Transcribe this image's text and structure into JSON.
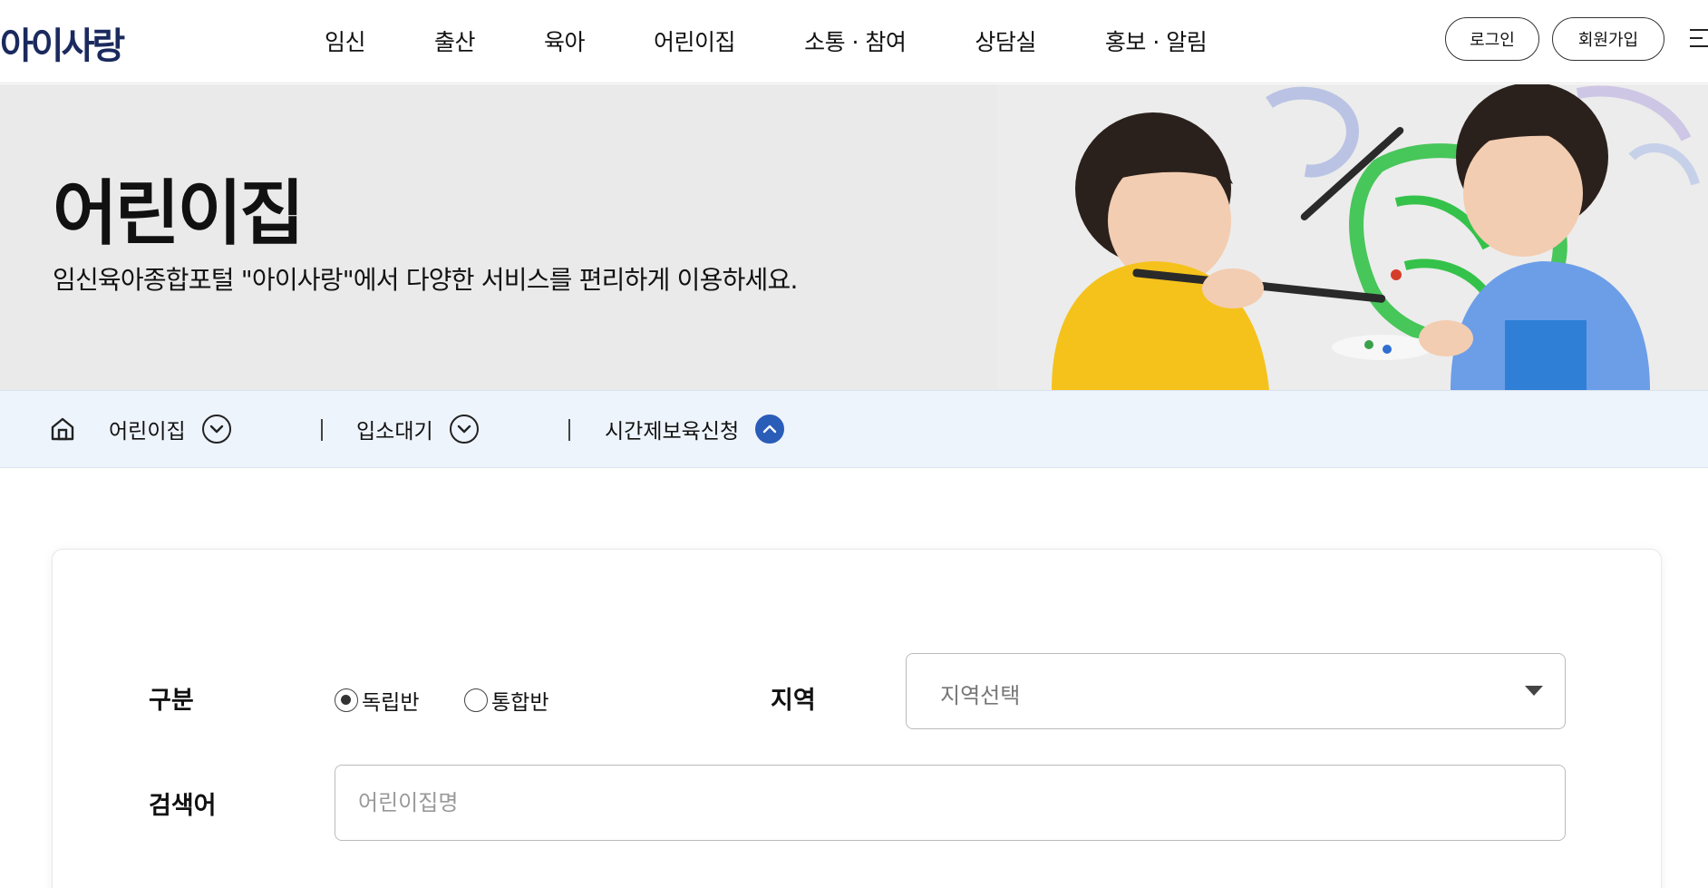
{
  "header": {
    "logo": "아이사랑",
    "nav": [
      "임신",
      "출산",
      "육아",
      "어린이집",
      "소통 · 참여",
      "상담실",
      "홍보 · 알림"
    ],
    "login_label": "로그인",
    "signup_label": "회원가입"
  },
  "hero": {
    "title": "어린이집",
    "subtitle": "임신육아종합포털 \"아이사랑\"에서 다양한 서비스를 편리하게 이용하세요."
  },
  "location": {
    "items": [
      {
        "label": "어린이집",
        "state": "collapsed"
      },
      {
        "label": "입소대기",
        "state": "collapsed"
      },
      {
        "label": "시간제보육신청",
        "state": "expanded"
      }
    ]
  },
  "search": {
    "type_label": "구분",
    "type_options": [
      {
        "label": "독립반",
        "checked": true
      },
      {
        "label": "통합반",
        "checked": false
      }
    ],
    "region_label": "지역",
    "region_value": "지역선택",
    "keyword_label": "검색어",
    "keyword_placeholder": "어린이집명"
  },
  "colors": {
    "brand": "#1b2a5e",
    "accent_blue": "#2a5db8",
    "locbar_bg": "#eef4fc",
    "hero_bg": "#eaeaea"
  },
  "icons": [
    "home-icon",
    "chevron-down-icon",
    "chevron-up-icon",
    "menu-icon",
    "caret-down-icon"
  ]
}
